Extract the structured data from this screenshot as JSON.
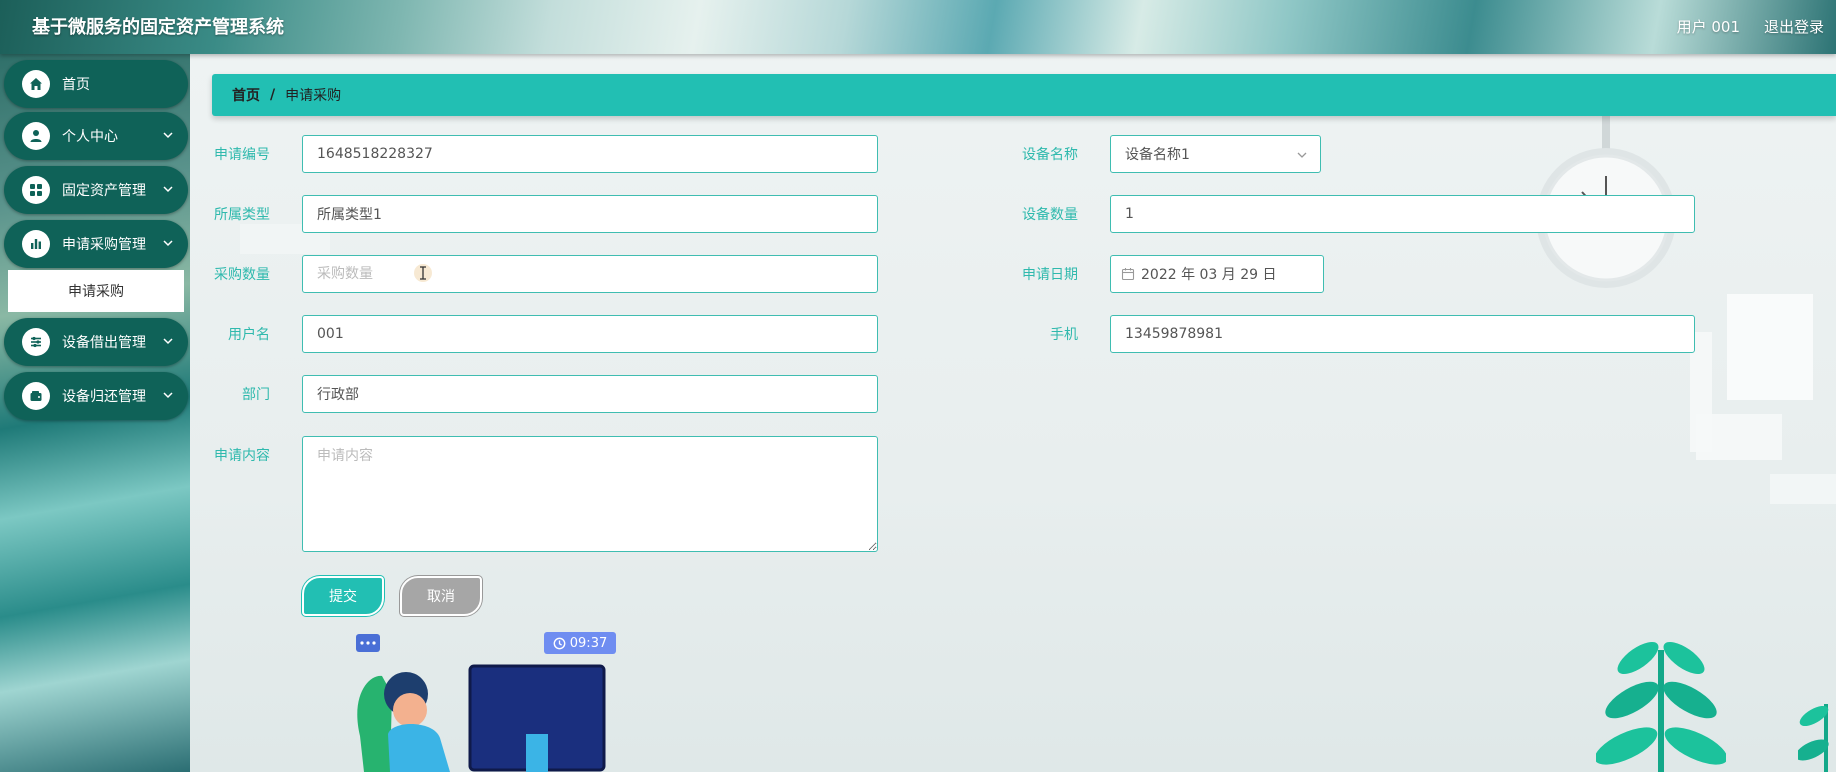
{
  "header": {
    "title": "基于微服务的固定资产管理系统",
    "user_label": "用户 001",
    "logout_label": "退出登录"
  },
  "sidebar": {
    "items": [
      {
        "label": "首页",
        "icon": "home-icon"
      },
      {
        "label": "个人中心",
        "icon": "user-icon"
      },
      {
        "label": "固定资产管理",
        "icon": "grid-icon"
      },
      {
        "label": "申请采购管理",
        "icon": "bar-chart-icon"
      },
      {
        "label": "设备借出管理",
        "icon": "sliders-icon"
      },
      {
        "label": "设备归还管理",
        "icon": "wallet-icon"
      }
    ],
    "active_subitem": "申请采购"
  },
  "breadcrumb": {
    "home": "首页",
    "separator": "/",
    "current": "申请采购"
  },
  "form": {
    "apply_no": {
      "label": "申请编号",
      "value": "1648518228327"
    },
    "type": {
      "label": "所属类型",
      "value": "所属类型1"
    },
    "purchase_qty": {
      "label": "采购数量",
      "placeholder": "采购数量"
    },
    "username": {
      "label": "用户名",
      "value": "001"
    },
    "department": {
      "label": "部门",
      "value": "行政部"
    },
    "content": {
      "label": "申请内容",
      "placeholder": "申请内容"
    },
    "device_name": {
      "label": "设备名称",
      "value": "设备名称1"
    },
    "device_qty": {
      "label": "设备数量",
      "value": "1"
    },
    "apply_date": {
      "label": "申请日期",
      "value": "2022 年 03 月 29 日"
    },
    "phone": {
      "label": "手机",
      "value": "13459878981"
    }
  },
  "buttons": {
    "submit": "提交",
    "cancel": "取消"
  },
  "illustration": {
    "clock_time": "09:37"
  },
  "colors": {
    "accent": "#22bfb3",
    "nav_bg": "#0f6258",
    "cancel": "#a6a6a6"
  }
}
